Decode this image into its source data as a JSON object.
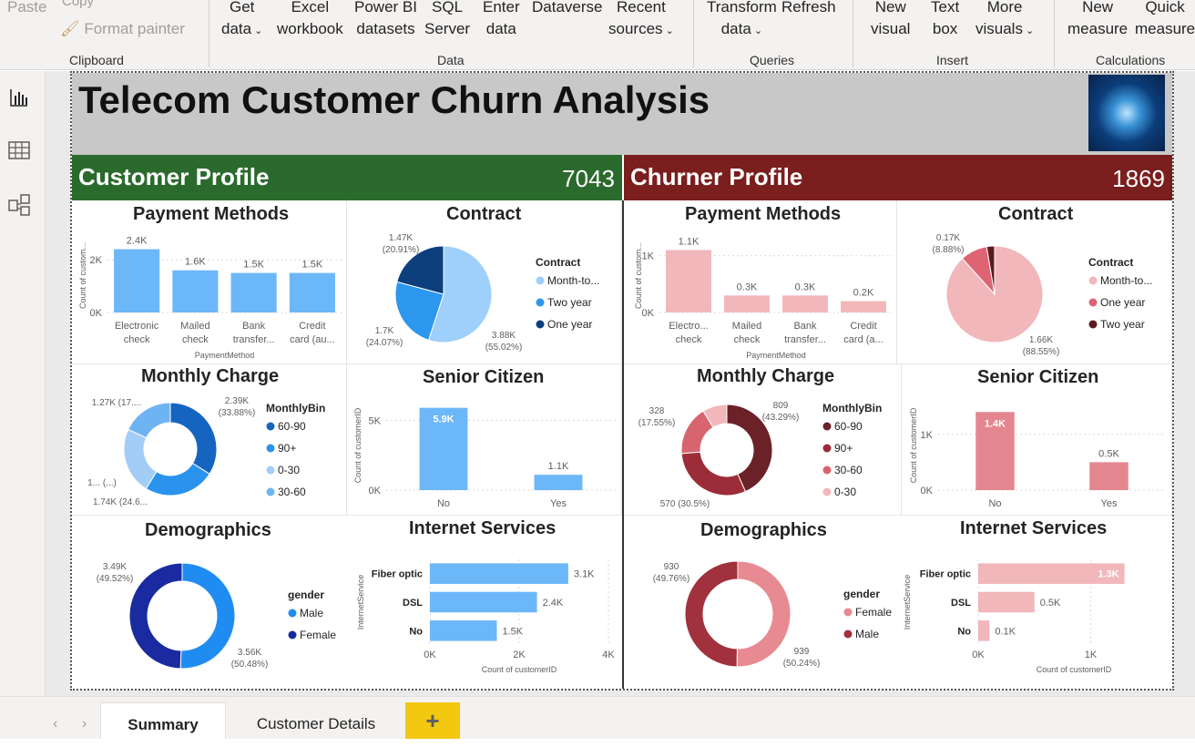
{
  "ribbon": {
    "paste": "Paste",
    "copy": "Copy",
    "format_painter": "Format painter",
    "get_data": [
      "Get",
      "data"
    ],
    "excel": [
      "Excel",
      "workbook"
    ],
    "powerbi": [
      "Power BI",
      "datasets"
    ],
    "sql": [
      "SQL",
      "Server"
    ],
    "enter": [
      "Enter",
      "data"
    ],
    "dataverse": "Dataverse",
    "recent": [
      "Recent",
      "sources"
    ],
    "transform": [
      "Transform",
      "data"
    ],
    "refresh": "Refresh",
    "new_visual": [
      "New",
      "visual"
    ],
    "text_box": [
      "Text",
      "box"
    ],
    "more_visuals": [
      "More",
      "visuals"
    ],
    "new_measure": [
      "New",
      "measure"
    ],
    "quick_measure": [
      "Quick",
      "measure"
    ],
    "groups": {
      "clipboard": "Clipboard",
      "data": "Data",
      "queries": "Queries",
      "insert": "Insert",
      "calculations": "Calculations"
    }
  },
  "report": {
    "title": "Telecom Customer Churn Analysis",
    "customer_label": "Customer Profile",
    "customer_count": "7043",
    "churner_label": "Churner Profile",
    "churner_count": "1869",
    "colors": {
      "customer_band": "#2b6a2d",
      "churner_band": "#7b1e1e"
    }
  },
  "visual_titles": {
    "payment": "Payment Methods",
    "contract": "Contract",
    "monthly": "Monthly Charge",
    "senior": "Senior Citizen",
    "demo": "Demographics",
    "internet": "Internet Services"
  },
  "tabs": {
    "summary": "Summary",
    "details": "Customer Details",
    "add": "+"
  },
  "chart_data": [
    {
      "id": "cust_payment",
      "type": "bar",
      "categories": [
        "Electronic check",
        "Mailed check",
        "Bank transfer...",
        "Credit card (au..."
      ],
      "values": [
        2.4,
        1.6,
        1.5,
        1.5
      ],
      "data_labels": [
        "2.4K",
        "1.6K",
        "1.5K",
        "1.5K"
      ],
      "ylabel": "Count of custom...",
      "xlabel": "PaymentMethod",
      "yticks": [
        "0K",
        "2K"
      ],
      "ylim": [
        0,
        2.8
      ],
      "color": "#6cb7f8"
    },
    {
      "id": "cust_contract",
      "type": "pie",
      "legend_title": "Contract",
      "slices": [
        {
          "name": "Month-to...",
          "value": 3.88,
          "label": "3.88K",
          "pct": "(55.02%)",
          "color": "#9fcffb"
        },
        {
          "name": "Two year",
          "value": 1.7,
          "label": "1.7K",
          "pct": "(24.07%)",
          "color": "#2c97ee"
        },
        {
          "name": "One year",
          "value": 1.47,
          "label": "1.47K",
          "pct": "(20.91%)",
          "color": "#0c3f7c"
        }
      ],
      "legend": [
        "Month-to...",
        "Two year",
        "One year"
      ]
    },
    {
      "id": "cust_monthly",
      "type": "donut",
      "legend_title": "MonthlyBin",
      "slices": [
        {
          "name": "60-90",
          "value": 2.39,
          "label": "2.39K",
          "pct": "(33.88%)",
          "color": "#1565c0"
        },
        {
          "name": "90+",
          "value": 1.74,
          "label": "1.74K (24.6...",
          "pct": "",
          "color": "#2a93ee"
        },
        {
          "name": "0-30",
          "value": 1.63,
          "label": "1... (...)",
          "pct": "",
          "color": "#a2cdf6"
        },
        {
          "name": "30-60",
          "value": 1.27,
          "label": "1.27K (17....",
          "pct": "",
          "color": "#6fb4f2"
        }
      ],
      "legend": [
        "60-90",
        "90+",
        "0-30",
        "30-60"
      ]
    },
    {
      "id": "cust_senior",
      "type": "bar",
      "categories": [
        "No",
        "Yes"
      ],
      "values": [
        5.9,
        1.1
      ],
      "data_labels": [
        "5.9K",
        "1.1K"
      ],
      "ylabel": "Count of customerID",
      "yticks": [
        "0K",
        "5K"
      ],
      "ylim": [
        0,
        6.4
      ],
      "color": "#6cb7f8"
    },
    {
      "id": "cust_demo",
      "type": "donut",
      "legend_title": "gender",
      "slices": [
        {
          "name": "Male",
          "value": 3.56,
          "label": "3.56K",
          "pct": "(50.48%)",
          "color": "#1f8cf2"
        },
        {
          "name": "Female",
          "value": 3.49,
          "label": "3.49K",
          "pct": "(49.52%)",
          "color": "#1a2aa0"
        }
      ],
      "legend": [
        "Male",
        "Female"
      ]
    },
    {
      "id": "cust_internet",
      "type": "hbar",
      "categories": [
        "Fiber optic",
        "DSL",
        "No"
      ],
      "values": [
        3.1,
        2.4,
        1.5
      ],
      "data_labels": [
        "3.1K",
        "2.4K",
        "1.5K"
      ],
      "ylabel": "InternetService",
      "xlabel": "Count of customerID",
      "xticks": [
        "0K",
        "2K",
        "4K"
      ],
      "xlim": [
        0,
        4
      ],
      "color": "#6cb7f8"
    },
    {
      "id": "churn_payment",
      "type": "bar",
      "categories": [
        "Electro... check",
        "Mailed check",
        "Bank transfer...",
        "Credit card (a..."
      ],
      "values": [
        1.1,
        0.3,
        0.3,
        0.2
      ],
      "data_labels": [
        "1.1K",
        "0.3K",
        "0.3K",
        "0.2K"
      ],
      "ylabel": "Count of custom...",
      "xlabel": "PaymentMethod",
      "yticks": [
        "0K",
        "1K"
      ],
      "ylim": [
        0,
        1.3
      ],
      "color": "#f1b7bb"
    },
    {
      "id": "churn_contract",
      "type": "pie",
      "legend_title": "Contract",
      "slices": [
        {
          "name": "Month-to...",
          "value": 1.66,
          "label": "1.66K",
          "pct": "(88.55%)",
          "color": "#f1b7bb"
        },
        {
          "name": "One year",
          "value": 0.17,
          "label": "0.17K",
          "pct": "(8.88%)",
          "color": "#de6473"
        },
        {
          "name": "Two year",
          "value": 0.05,
          "label": "",
          "pct": "",
          "color": "#5c1a1d"
        }
      ],
      "legend": [
        "Month-to...",
        "One year",
        "Two year"
      ]
    },
    {
      "id": "churn_monthly",
      "type": "donut",
      "legend_title": "MonthlyBin",
      "slices": [
        {
          "name": "60-90",
          "value": 809,
          "label": "809",
          "pct": "(43.29%)",
          "color": "#6b2128"
        },
        {
          "name": "90+",
          "value": 570,
          "label": "570 (30.5%)",
          "pct": "",
          "color": "#9c2d38"
        },
        {
          "name": "30-60",
          "value": 328,
          "label": "328",
          "pct": "(17.55%)",
          "color": "#d8646f"
        },
        {
          "name": "0-30",
          "value": 162,
          "label": "",
          "pct": "",
          "color": "#f1b7bb"
        }
      ],
      "legend": [
        "60-90",
        "90+",
        "30-60",
        "0-30"
      ]
    },
    {
      "id": "churn_senior",
      "type": "bar",
      "categories": [
        "No",
        "Yes"
      ],
      "values": [
        1.4,
        0.5
      ],
      "data_labels": [
        "1.4K",
        "0.5K"
      ],
      "ylabel": "Count of customerID",
      "yticks": [
        "0K",
        "1K"
      ],
      "ylim": [
        0,
        1.6
      ],
      "color": "#e4868f"
    },
    {
      "id": "churn_demo",
      "type": "donut",
      "legend_title": "gender",
      "slices": [
        {
          "name": "Female",
          "value": 939,
          "label": "939",
          "pct": "(50.24%)",
          "color": "#e88a92"
        },
        {
          "name": "Male",
          "value": 930,
          "label": "930",
          "pct": "(49.76%)",
          "color": "#a1313d"
        }
      ],
      "legend": [
        "Female",
        "Male"
      ]
    },
    {
      "id": "churn_internet",
      "type": "hbar",
      "categories": [
        "Fiber optic",
        "DSL",
        "No"
      ],
      "values": [
        1.3,
        0.5,
        0.1
      ],
      "data_labels": [
        "1.3K",
        "0.5K",
        "0.1K"
      ],
      "ylabel": "InternetService",
      "xlabel": "Count of customerID",
      "xticks": [
        "0K",
        "1K"
      ],
      "xlim": [
        0,
        1.7
      ],
      "color": "#f1b7bb"
    }
  ]
}
